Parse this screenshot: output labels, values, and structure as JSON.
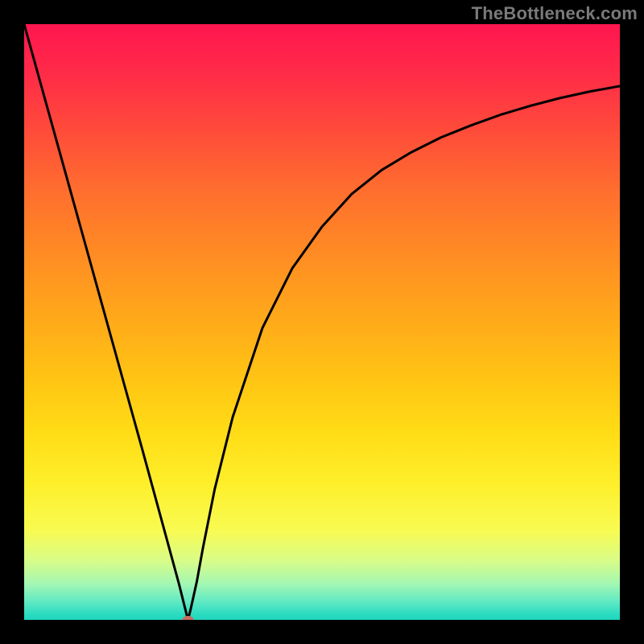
{
  "watermark": "TheBottleneck.com",
  "chart_data": {
    "type": "line",
    "title": "",
    "xlabel": "",
    "ylabel": "",
    "xlim": [
      0,
      100
    ],
    "ylim": [
      0,
      100
    ],
    "series": [
      {
        "name": "curve",
        "x": [
          0,
          5,
          10,
          15,
          20,
          23,
          26,
          27,
          27.5,
          28,
          29,
          30,
          32,
          35,
          40,
          45,
          50,
          55,
          60,
          65,
          70,
          75,
          80,
          85,
          90,
          95,
          100
        ],
        "values": [
          100,
          82,
          64,
          46,
          28,
          17,
          6,
          2,
          0,
          2,
          6.5,
          12,
          22,
          34,
          49,
          59,
          66,
          71.5,
          75.5,
          78.5,
          81,
          83,
          84.8,
          86.3,
          87.6,
          88.7,
          89.6
        ]
      }
    ],
    "markers": [
      {
        "name": "min-point",
        "x": 27.5,
        "y": 0,
        "color": "#c96a60",
        "rx": 7,
        "ry": 5
      }
    ],
    "gradient_stops": [
      {
        "pos": 0,
        "color": "#ff164f"
      },
      {
        "pos": 50,
        "color": "#ffb317"
      },
      {
        "pos": 85,
        "color": "#f8fb52"
      },
      {
        "pos": 100,
        "color": "#1fd6be"
      }
    ]
  },
  "layout": {
    "image_size": 800,
    "frame_inset": 30,
    "plot_size": 740
  }
}
